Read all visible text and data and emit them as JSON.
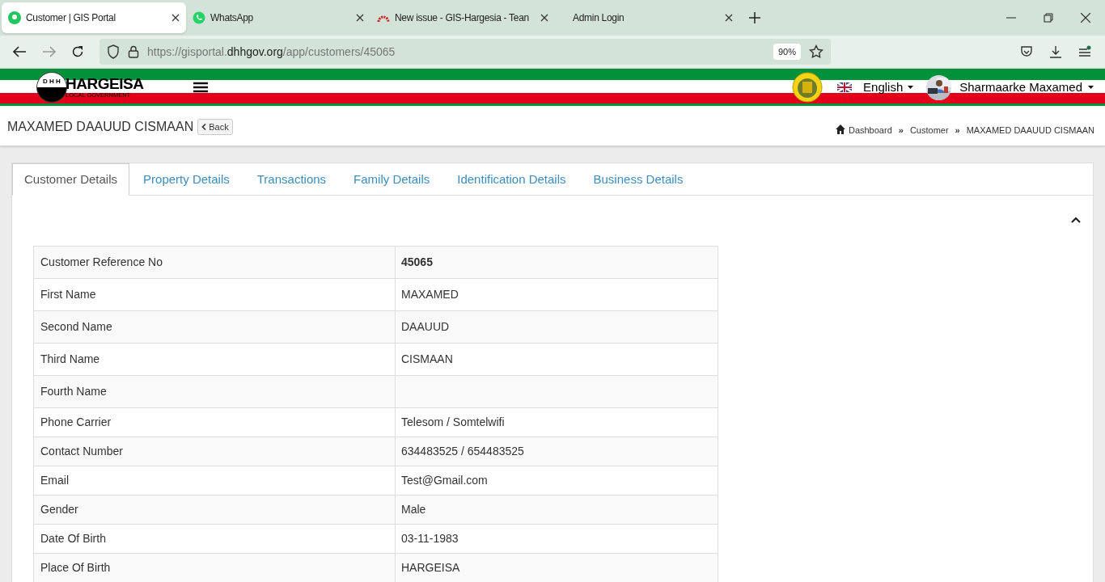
{
  "browser": {
    "tabs": [
      {
        "title": "Customer | GIS Portal",
        "selected": true
      },
      {
        "title": "WhatsApp",
        "selected": false
      },
      {
        "title": "New issue - GIS-Hargesia - Tean",
        "selected": false
      },
      {
        "title": "Admin Login",
        "selected": false
      }
    ],
    "url": {
      "prefix": "https://gisportal.",
      "domain": "dhhgov.org",
      "path": "/app/customers/45065"
    },
    "zoom": "90%"
  },
  "header": {
    "logo_letters": "D H H",
    "logo_title": "HARGEISA",
    "logo_subtitle": "LOCAL GOVERNMENT",
    "language": "English",
    "user": "Sharmaarke Maxamed"
  },
  "page": {
    "title": "MAXAMED DAAUUD CISMAAN",
    "back": "Back",
    "breadcrumb": [
      "Dashboard",
      "Customer",
      "MAXAMED DAAUUD CISMAAN"
    ],
    "separator": "»"
  },
  "tabs": [
    {
      "label": "Customer Details",
      "selected": true
    },
    {
      "label": "Property Details",
      "selected": false
    },
    {
      "label": "Transactions",
      "selected": false
    },
    {
      "label": "Family Details",
      "selected": false
    },
    {
      "label": "Identification Details",
      "selected": false
    },
    {
      "label": "Business Details",
      "selected": false
    }
  ],
  "table": {
    "rows": [
      {
        "label": "Customer Reference No",
        "value": "45065",
        "bold": true
      },
      {
        "label": "First Name",
        "value": "MAXAMED",
        "bold": false
      },
      {
        "label": "Second Name",
        "value": "DAAUUD",
        "bold": false
      },
      {
        "label": "Third Name",
        "value": "CISMAAN",
        "bold": false
      },
      {
        "label": "Fourth Name"
      },
      {
        "label": "Phone Carrier",
        "value": "Telesom / Somtelwifi",
        "bold": false
      },
      {
        "label": "Contact Number",
        "value": "634483525 / 654483525",
        "bold": false
      },
      {
        "label": "Email",
        "value": "Test@Gmail.com",
        "bold": false
      },
      {
        "label": "Gender",
        "value": "Male",
        "bold": false
      },
      {
        "label": "Date Of Birth",
        "value": "03-11-1983",
        "bold": false
      },
      {
        "label": "Place Of Birth",
        "value": "HARGEISA",
        "bold": false
      }
    ]
  }
}
